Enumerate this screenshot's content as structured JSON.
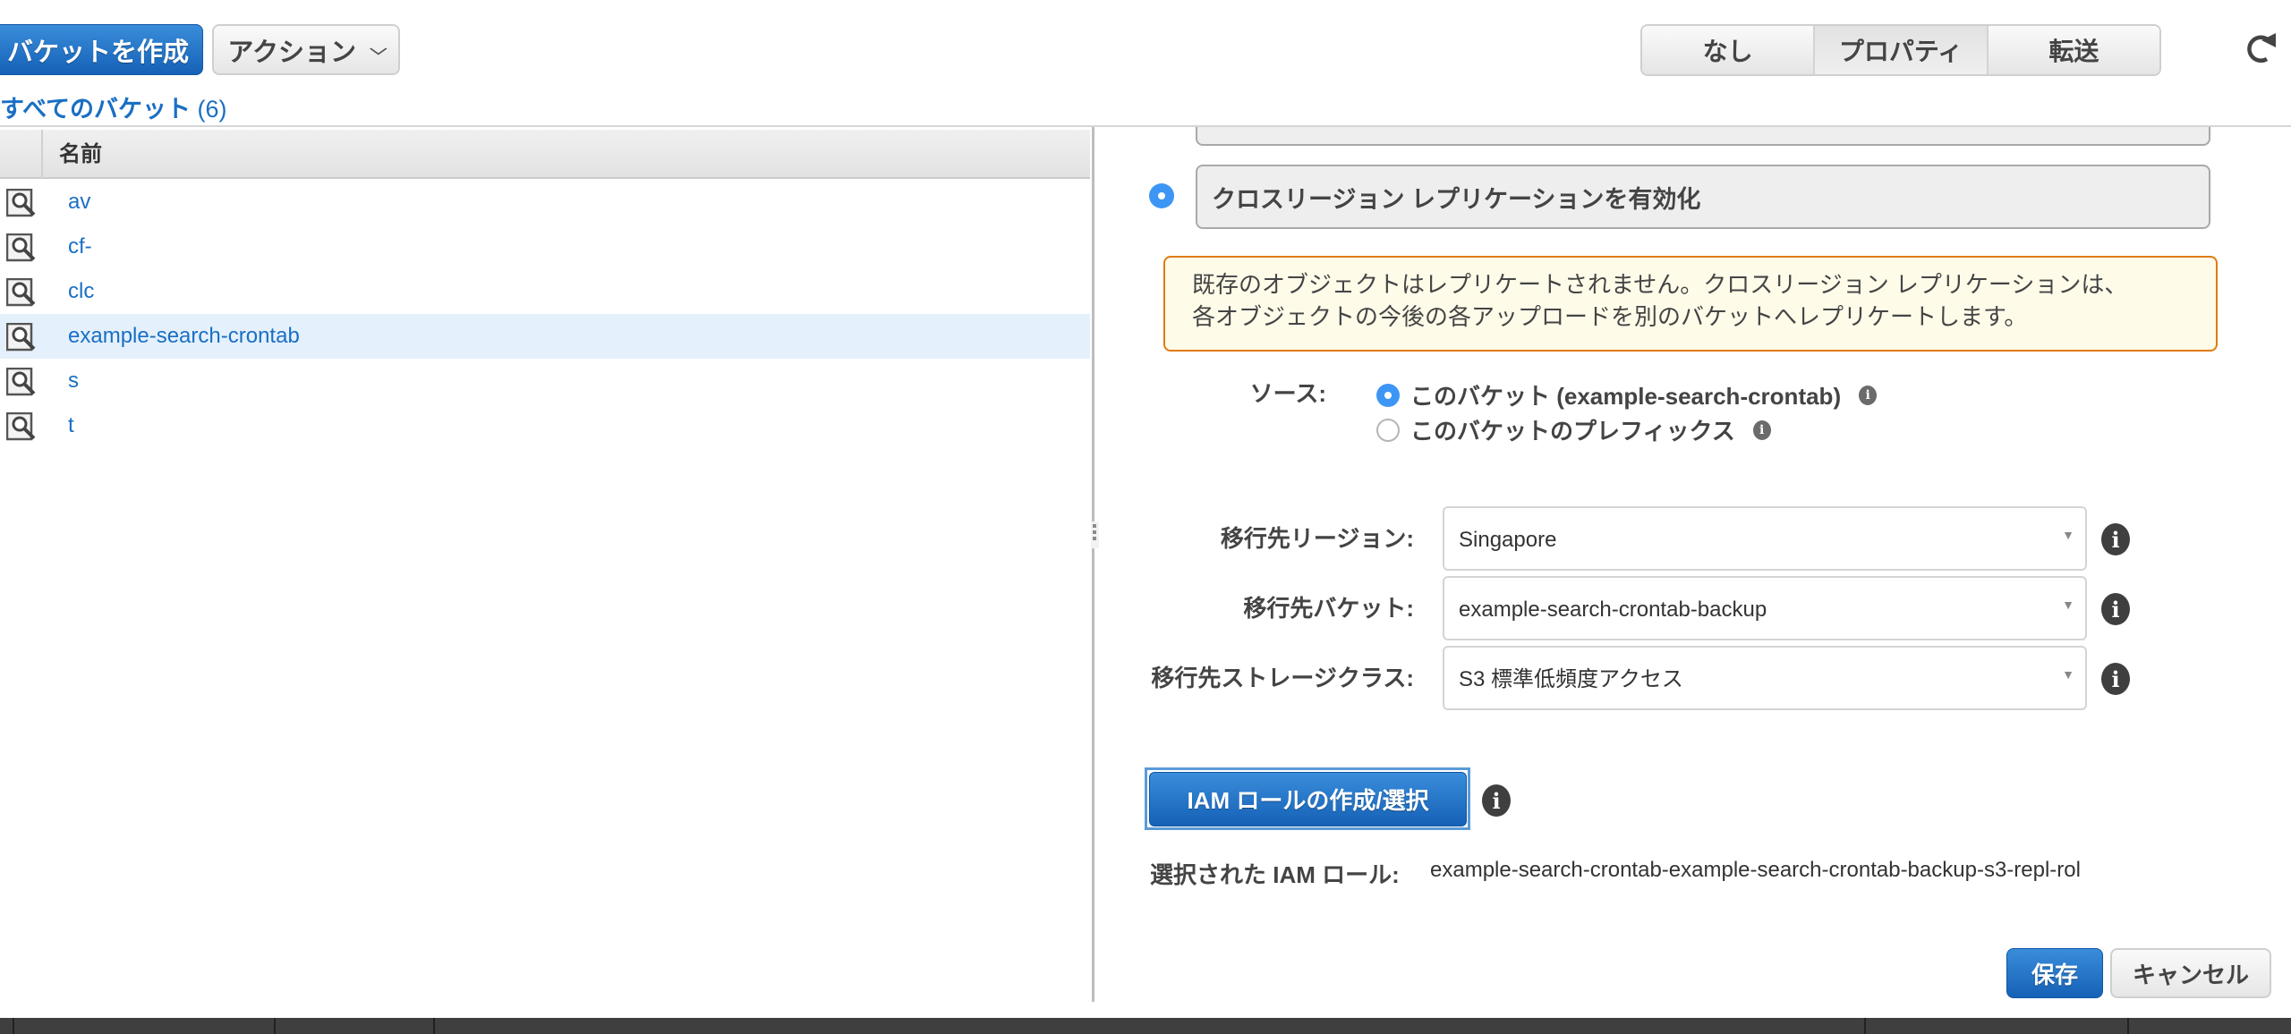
{
  "toolbar": {
    "create_bucket_label": "バケットを作成",
    "actions_label": "アクション",
    "actions_chevron": "⌄",
    "view_toggle": [
      {
        "label": "なし",
        "active": false
      },
      {
        "label": "プロパティ",
        "active": true
      },
      {
        "label": "転送",
        "active": false
      }
    ],
    "refresh_icon": "refresh-icon"
  },
  "bucket_list": {
    "title": "すべてのバケット",
    "count": "(6)",
    "column_header": "名前",
    "rows": [
      {
        "name": "av",
        "selected": false
      },
      {
        "name": "cf-",
        "selected": false
      },
      {
        "name": "clc",
        "selected": false
      },
      {
        "name": "example-search-crontab",
        "selected": true
      },
      {
        "name": "s",
        "selected": false
      },
      {
        "name": "t",
        "selected": false
      }
    ]
  },
  "properties": {
    "crr_option_label": "クロスリージョン レプリケーションを有効化",
    "crr_enabled": true,
    "warning": {
      "line1": "既存のオブジェクトはレプリケートされません。クロスリージョン レプリケーションは、",
      "line2": "各オブジェクトの今後の各アップロードを別のバケットへレプリケートします。"
    },
    "source": {
      "label": "ソース:",
      "options": [
        {
          "label": "このバケット (example-search-crontab)",
          "selected": true
        },
        {
          "label": "このバケットのプレフィックス",
          "selected": false
        }
      ]
    },
    "destination_region": {
      "label": "移行先リージョン:",
      "value": "Singapore"
    },
    "destination_bucket": {
      "label": "移行先バケット:",
      "value": "example-search-crontab-backup"
    },
    "destination_storage_class": {
      "label": "移行先ストレージクラス:",
      "value": "S3 標準低頻度アクセス"
    },
    "iam_button_label": "IAM ロールの作成/選択",
    "selected_iam_role": {
      "label": "選択された IAM ロール:",
      "value": "example-search-crontab-example-search-crontab-backup-s3-repl-rol"
    },
    "save_label": "保存",
    "cancel_label": "キャンセル"
  },
  "colors": {
    "primary": "#1a6fc4",
    "warning_border": "#e07b0f",
    "warning_bg": "#fffbe9",
    "selected_row": "#e4f0fc",
    "radio_on": "#3d96f5"
  },
  "info_glyph": "i"
}
